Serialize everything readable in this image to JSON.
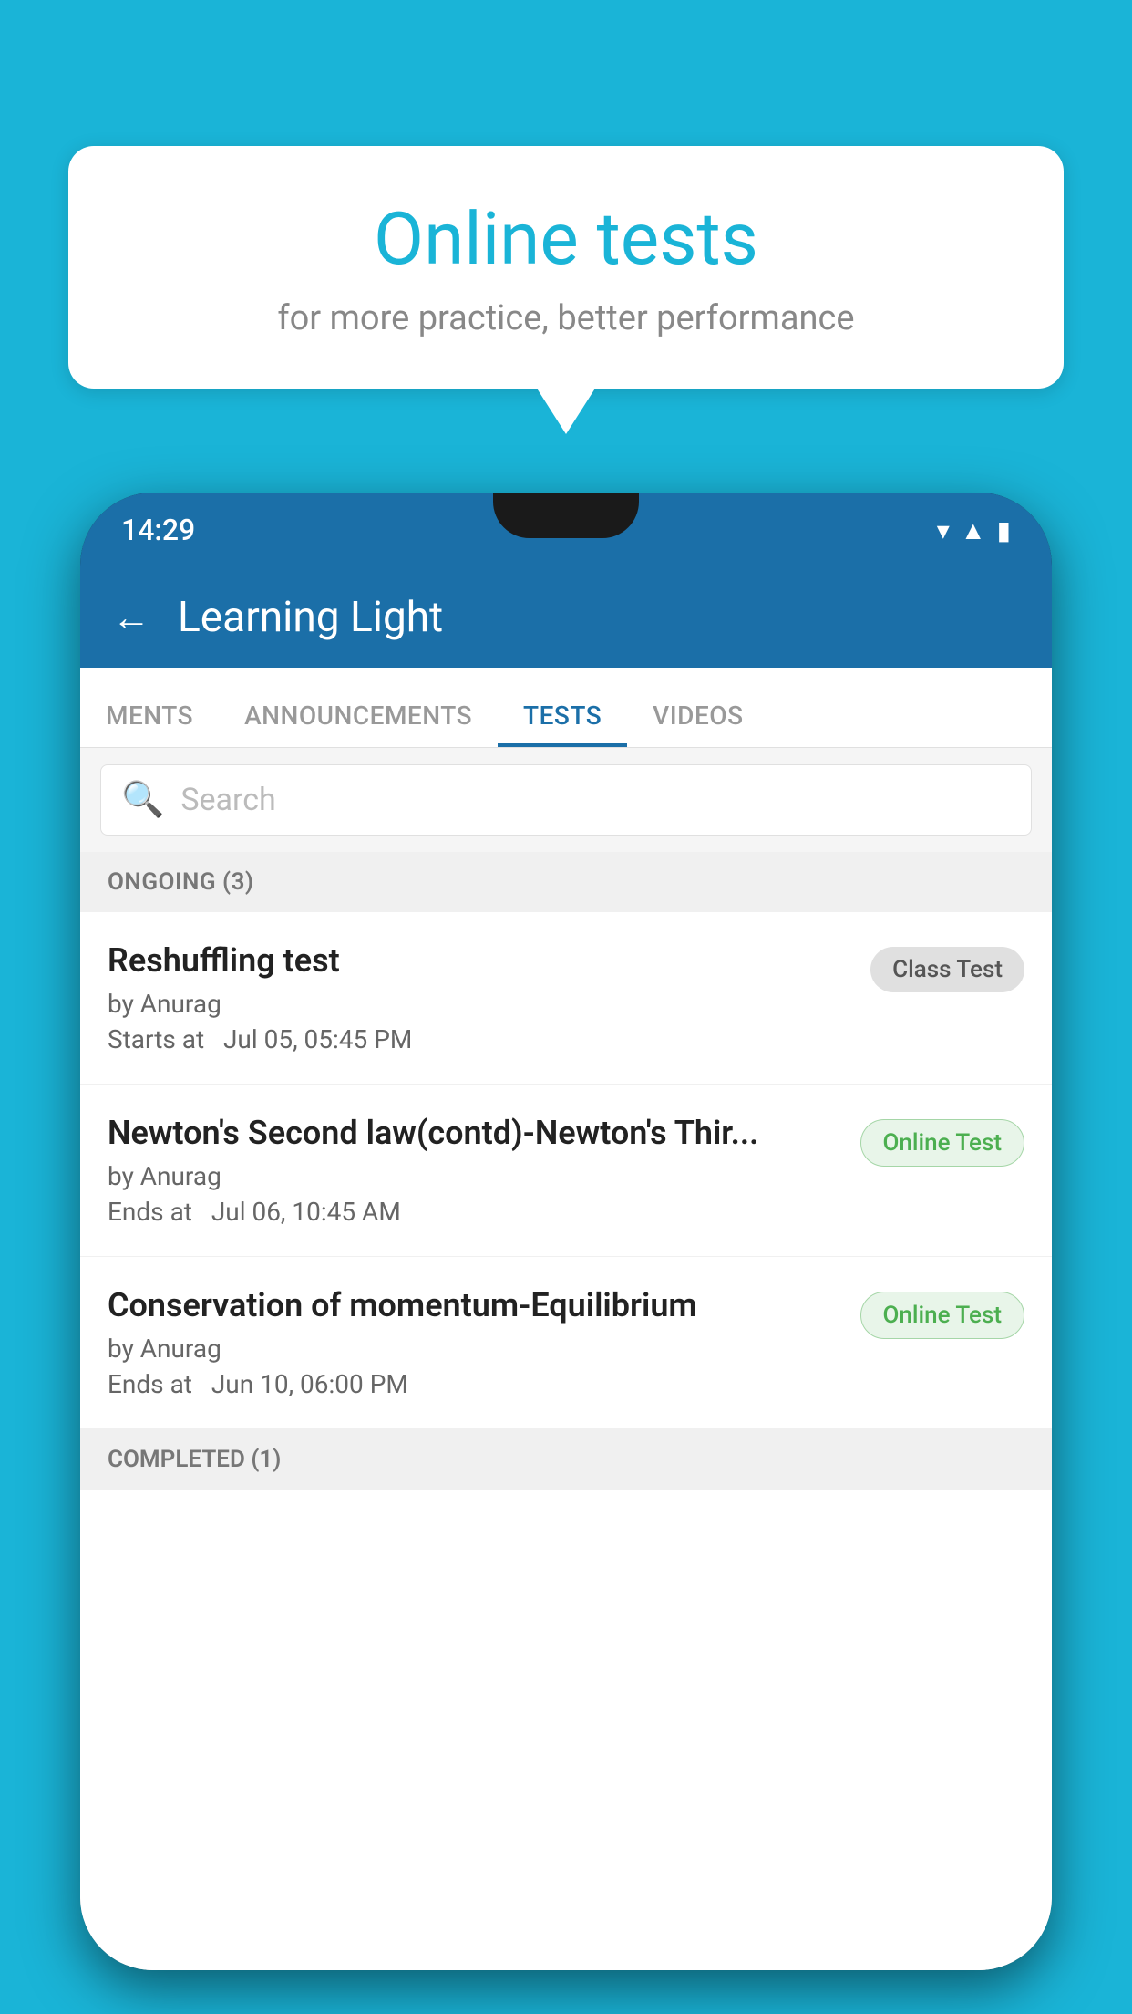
{
  "background": {
    "color": "#1ab4d7"
  },
  "speech_bubble": {
    "title": "Online tests",
    "subtitle": "for more practice, better performance"
  },
  "phone": {
    "status_bar": {
      "time": "14:29",
      "icons": [
        "wifi",
        "signal",
        "battery"
      ]
    },
    "app_bar": {
      "title": "Learning Light",
      "back_label": "←"
    },
    "tabs": [
      {
        "label": "MENTS",
        "active": false
      },
      {
        "label": "ANNOUNCEMENTS",
        "active": false
      },
      {
        "label": "TESTS",
        "active": true
      },
      {
        "label": "VIDEOS",
        "active": false
      }
    ],
    "search": {
      "placeholder": "Search"
    },
    "sections": [
      {
        "header": "ONGOING (3)",
        "tests": [
          {
            "name": "Reshuffling test",
            "by": "by Anurag",
            "date_label": "Starts at",
            "date": "Jul 05, 05:45 PM",
            "badge": "Class Test",
            "badge_type": "class"
          },
          {
            "name": "Newton's Second law(contd)-Newton's Thir...",
            "by": "by Anurag",
            "date_label": "Ends at",
            "date": "Jul 06, 10:45 AM",
            "badge": "Online Test",
            "badge_type": "online"
          },
          {
            "name": "Conservation of momentum-Equilibrium",
            "by": "by Anurag",
            "date_label": "Ends at",
            "date": "Jun 10, 06:00 PM",
            "badge": "Online Test",
            "badge_type": "online"
          }
        ]
      }
    ],
    "completed_header": "COMPLETED (1)"
  }
}
